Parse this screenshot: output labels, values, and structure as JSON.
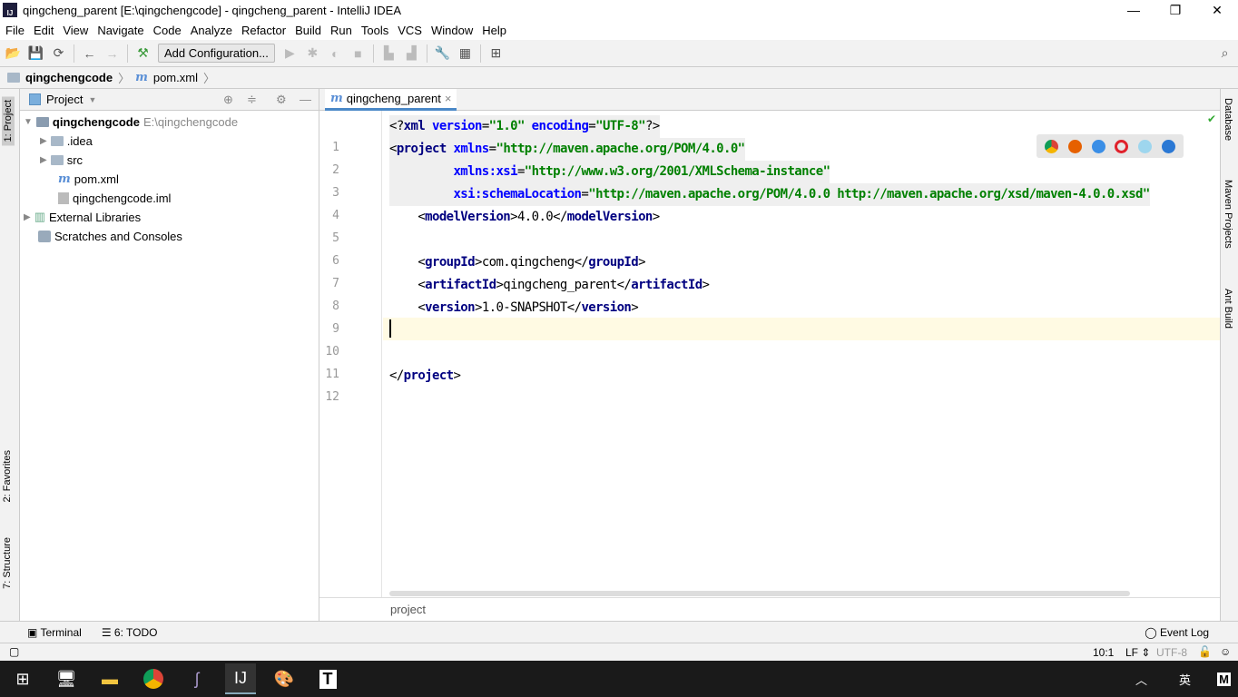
{
  "window": {
    "title": "qingcheng_parent [E:\\qingchengcode] - qingcheng_parent - IntelliJ IDEA",
    "app_icon": "IJ"
  },
  "menu": [
    "File",
    "Edit",
    "View",
    "Navigate",
    "Code",
    "Analyze",
    "Refactor",
    "Build",
    "Run",
    "Tools",
    "VCS",
    "Window",
    "Help"
  ],
  "toolbar": {
    "add_configuration": "Add Configuration..."
  },
  "breadcrumb": {
    "project": "qingchengcode",
    "file": "pom.xml"
  },
  "project_panel": {
    "title": "Project",
    "side_tabs": [
      "1: Project",
      "2: Favorites",
      "7: Structure"
    ],
    "root": {
      "name": "qingchengcode",
      "path": "E:\\qingchengcode"
    },
    "children": [
      ".idea",
      "src",
      "pom.xml",
      "qingchengcode.iml"
    ],
    "external": "External Libraries",
    "scratches": "Scratches and Consoles"
  },
  "editor": {
    "tab": "qingcheng_parent",
    "lines": [
      [
        [
          "pun",
          "<?"
        ],
        [
          "tag",
          "xml "
        ],
        [
          "attr",
          "version"
        ],
        [
          "pun",
          "="
        ],
        [
          "val",
          "\"1.0\""
        ],
        [
          "pun",
          " "
        ],
        [
          "attr",
          "encoding"
        ],
        [
          "pun",
          "="
        ],
        [
          "val",
          "\"UTF-8\""
        ],
        [
          "pun",
          "?>"
        ]
      ],
      [
        [
          "pun",
          "<"
        ],
        [
          "tag",
          "project "
        ],
        [
          "attr",
          "xmlns"
        ],
        [
          "pun",
          "="
        ],
        [
          "val",
          "\"http://maven.apache.org/POM/4.0.0\""
        ]
      ],
      [
        [
          "pun",
          "         "
        ],
        [
          "attr",
          "xmlns:xsi"
        ],
        [
          "pun",
          "="
        ],
        [
          "val",
          "\"http://www.w3.org/2001/XMLSchema-instance\""
        ]
      ],
      [
        [
          "pun",
          "         "
        ],
        [
          "attr",
          "xsi:schemaLocation"
        ],
        [
          "pun",
          "="
        ],
        [
          "val",
          "\"http://maven.apache.org/POM/4.0.0 http://maven.apache.org/xsd/maven-4.0.0.xsd\""
        ]
      ],
      [
        [
          "pun",
          "    <"
        ],
        [
          "tag",
          "modelVersion"
        ],
        [
          "pun",
          ">"
        ],
        [
          "txt",
          "4.0.0"
        ],
        [
          "pun",
          "</"
        ],
        [
          "tag",
          "modelVersion"
        ],
        [
          "pun",
          ">"
        ]
      ],
      [],
      [
        [
          "pun",
          "    <"
        ],
        [
          "tag",
          "groupId"
        ],
        [
          "pun",
          ">"
        ],
        [
          "txt",
          "com.qingcheng"
        ],
        [
          "pun",
          "</"
        ],
        [
          "tag",
          "groupId"
        ],
        [
          "pun",
          ">"
        ]
      ],
      [
        [
          "pun",
          "    <"
        ],
        [
          "tag",
          "artifactId"
        ],
        [
          "pun",
          ">"
        ],
        [
          "txt",
          "qingcheng_parent"
        ],
        [
          "pun",
          "</"
        ],
        [
          "tag",
          "artifactId"
        ],
        [
          "pun",
          ">"
        ]
      ],
      [
        [
          "pun",
          "    <"
        ],
        [
          "tag",
          "version"
        ],
        [
          "pun",
          ">"
        ],
        [
          "txt",
          "1.0-SNAPSHOT"
        ],
        [
          "pun",
          "</"
        ],
        [
          "tag",
          "version"
        ],
        [
          "pun",
          ">"
        ]
      ],
      [],
      [],
      [
        [
          "pun",
          "</"
        ],
        [
          "tag",
          "project"
        ],
        [
          "pun",
          ">"
        ]
      ]
    ],
    "breadcrumb": "project"
  },
  "right_tabs": [
    "Database",
    "Maven Projects",
    "Ant Build"
  ],
  "bottom_tabs": [
    "Terminal",
    "6: TODO"
  ],
  "event_log": "Event Log",
  "status": {
    "position": "10:1",
    "line_sep": "LF",
    "encoding": "UTF-8"
  },
  "tray": {
    "ime": "英",
    "m": "M"
  }
}
